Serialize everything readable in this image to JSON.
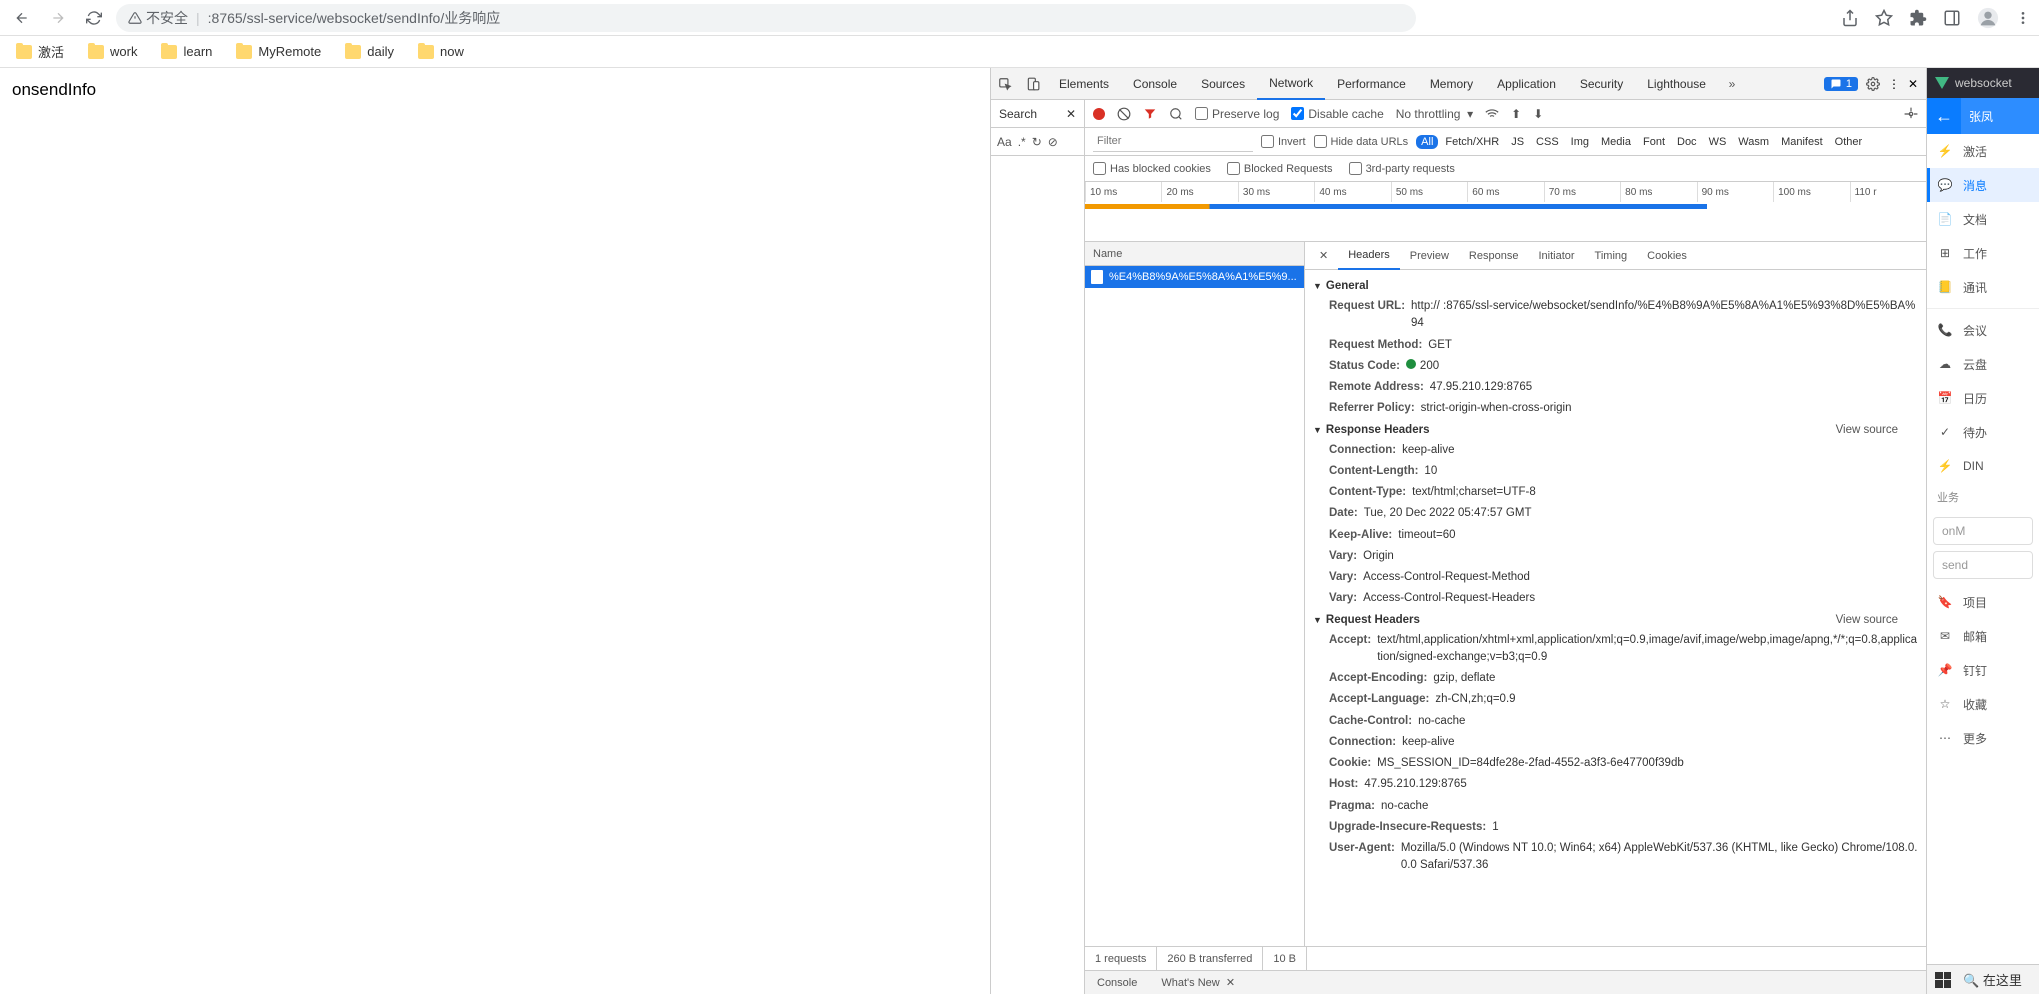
{
  "browser": {
    "security_label": "不安全",
    "url_display": ":8765/ssl-service/websocket/sendInfo/业务响应",
    "bookmarks": [
      "激活",
      "work",
      "learn",
      "MyRemote",
      "daily",
      "now"
    ]
  },
  "page": {
    "body_text": "onsendInfo"
  },
  "devtools": {
    "tabs": [
      "Elements",
      "Console",
      "Sources",
      "Network",
      "Performance",
      "Memory",
      "Application",
      "Security",
      "Lighthouse"
    ],
    "active_tab": "Network",
    "issue_count": "1",
    "search": {
      "title": "Search",
      "aa": "Aa",
      "regex": ".*"
    },
    "toolbar": {
      "preserve_log": "Preserve log",
      "disable_cache": "Disable cache",
      "throttling": "No throttling"
    },
    "filter": {
      "placeholder": "Filter",
      "invert": "Invert",
      "hide_data_urls": "Hide data URLs",
      "types": [
        "All",
        "Fetch/XHR",
        "JS",
        "CSS",
        "Img",
        "Media",
        "Font",
        "Doc",
        "WS",
        "Wasm",
        "Manifest",
        "Other"
      ],
      "has_blocked_cookies": "Has blocked cookies",
      "blocked_requests": "Blocked Requests",
      "third_party": "3rd-party requests"
    },
    "timeline_ticks": [
      "10 ms",
      "20 ms",
      "30 ms",
      "40 ms",
      "50 ms",
      "60 ms",
      "70 ms",
      "80 ms",
      "90 ms",
      "100 ms",
      "110 r"
    ],
    "request_list": {
      "header": "Name",
      "items": [
        "%E4%B8%9A%E5%8A%A1%E5%9..."
      ]
    },
    "detail_tabs": [
      "Headers",
      "Preview",
      "Response",
      "Initiator",
      "Timing",
      "Cookies"
    ],
    "sections": {
      "general": {
        "title": "General",
        "rows": [
          {
            "k": "Request URL:",
            "v": "http://             :8765/ssl-service/websocket/sendInfo/%E4%B8%9A%E5%8A%A1%E5%93%8D%E5%BA%94"
          },
          {
            "k": "Request Method:",
            "v": "GET"
          },
          {
            "k": "Status Code:",
            "v": "200",
            "status": true
          },
          {
            "k": "Remote Address:",
            "v": "47.95.210.129:8765"
          },
          {
            "k": "Referrer Policy:",
            "v": "strict-origin-when-cross-origin"
          }
        ]
      },
      "response": {
        "title": "Response Headers",
        "view_source": "View source",
        "rows": [
          {
            "k": "Connection:",
            "v": "keep-alive"
          },
          {
            "k": "Content-Length:",
            "v": "10"
          },
          {
            "k": "Content-Type:",
            "v": "text/html;charset=UTF-8"
          },
          {
            "k": "Date:",
            "v": "Tue, 20 Dec 2022 05:47:57 GMT"
          },
          {
            "k": "Keep-Alive:",
            "v": "timeout=60"
          },
          {
            "k": "Vary:",
            "v": "Origin"
          },
          {
            "k": "Vary:",
            "v": "Access-Control-Request-Method"
          },
          {
            "k": "Vary:",
            "v": "Access-Control-Request-Headers"
          }
        ]
      },
      "request": {
        "title": "Request Headers",
        "view_source": "View source",
        "rows": [
          {
            "k": "Accept:",
            "v": "text/html,application/xhtml+xml,application/xml;q=0.9,image/avif,image/webp,image/apng,*/*;q=0.8,application/signed-exchange;v=b3;q=0.9"
          },
          {
            "k": "Accept-Encoding:",
            "v": "gzip, deflate"
          },
          {
            "k": "Accept-Language:",
            "v": "zh-CN,zh;q=0.9"
          },
          {
            "k": "Cache-Control:",
            "v": "no-cache"
          },
          {
            "k": "Connection:",
            "v": "keep-alive"
          },
          {
            "k": "Cookie:",
            "v": "MS_SESSION_ID=84dfe28e-2fad-4552-a3f3-6e47700f39db"
          },
          {
            "k": "Host:",
            "v": "47.95.210.129:8765"
          },
          {
            "k": "Pragma:",
            "v": "no-cache"
          },
          {
            "k": "Upgrade-Insecure-Requests:",
            "v": "1"
          },
          {
            "k": "User-Agent:",
            "v": "Mozilla/5.0 (Windows NT 10.0; Win64; x64) AppleWebKit/537.36 (KHTML, like Gecko) Chrome/108.0.0.0 Safari/537.36"
          }
        ]
      }
    },
    "footer": [
      "1 requests",
      "260 B transferred",
      "10 B"
    ],
    "drawer": {
      "console": "Console",
      "whats_new": "What's New"
    }
  },
  "side": {
    "header": "websocket",
    "user": "张凤",
    "nav1": [
      {
        "icon": "⚡",
        "label": "激活"
      },
      {
        "icon": "💬",
        "label": "消息",
        "active": true
      },
      {
        "icon": "📄",
        "label": "文档"
      },
      {
        "icon": "⊞",
        "label": "工作"
      },
      {
        "icon": "📒",
        "label": "通讯"
      }
    ],
    "nav2": [
      {
        "icon": "📞",
        "label": "会议"
      },
      {
        "icon": "☁",
        "label": "云盘"
      },
      {
        "icon": "📅",
        "label": "日历"
      },
      {
        "icon": "✓",
        "label": "待办"
      },
      {
        "icon": "⚡",
        "label": "DIN"
      }
    ],
    "category": "业务",
    "nav3": [
      {
        "icon": "🔖",
        "label": "项目"
      },
      {
        "icon": "✉",
        "label": "邮箱"
      },
      {
        "icon": "📌",
        "label": "钉钉"
      },
      {
        "icon": "☆",
        "label": "收藏"
      },
      {
        "icon": "⋯",
        "label": "更多"
      }
    ],
    "input1": "onM",
    "input2": "send"
  },
  "taskbar": {
    "search": "在这里"
  }
}
